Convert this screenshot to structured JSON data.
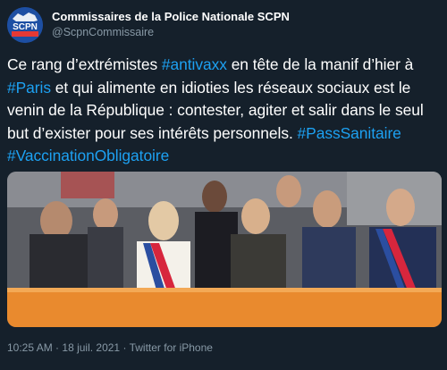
{
  "account": {
    "display_name": "Commissaires de la Police Nationale SCPN",
    "handle": "@ScpnCommissaire",
    "avatar_text": "SCPN"
  },
  "tweet": {
    "segments": [
      {
        "text": "Ce rang d’extrémistes ",
        "tag": false
      },
      {
        "text": "#antivaxx",
        "tag": true
      },
      {
        "text": " en tête de la manif d’hier à ",
        "tag": false
      },
      {
        "text": "#Paris",
        "tag": true
      },
      {
        "text": " et qui alimente en idioties les réseaux sociaux est le venin de la République : contester, agiter et salir dans le seul but d’exister pour ses intérêts personnels. ",
        "tag": false
      },
      {
        "text": "#PassSanitaire",
        "tag": true
      },
      {
        "text": " ",
        "tag": false
      },
      {
        "text": "#VaccinationObligatoire",
        "tag": true
      }
    ]
  },
  "meta": {
    "time": "10:25 AM",
    "date": "18 juil. 2021",
    "source": "Twitter for iPhone",
    "separator": "·"
  },
  "colors": {
    "background": "#15202b",
    "hashtag": "#1da1f2",
    "secondary_text": "#8899a6",
    "banner": "#e98a2e"
  }
}
